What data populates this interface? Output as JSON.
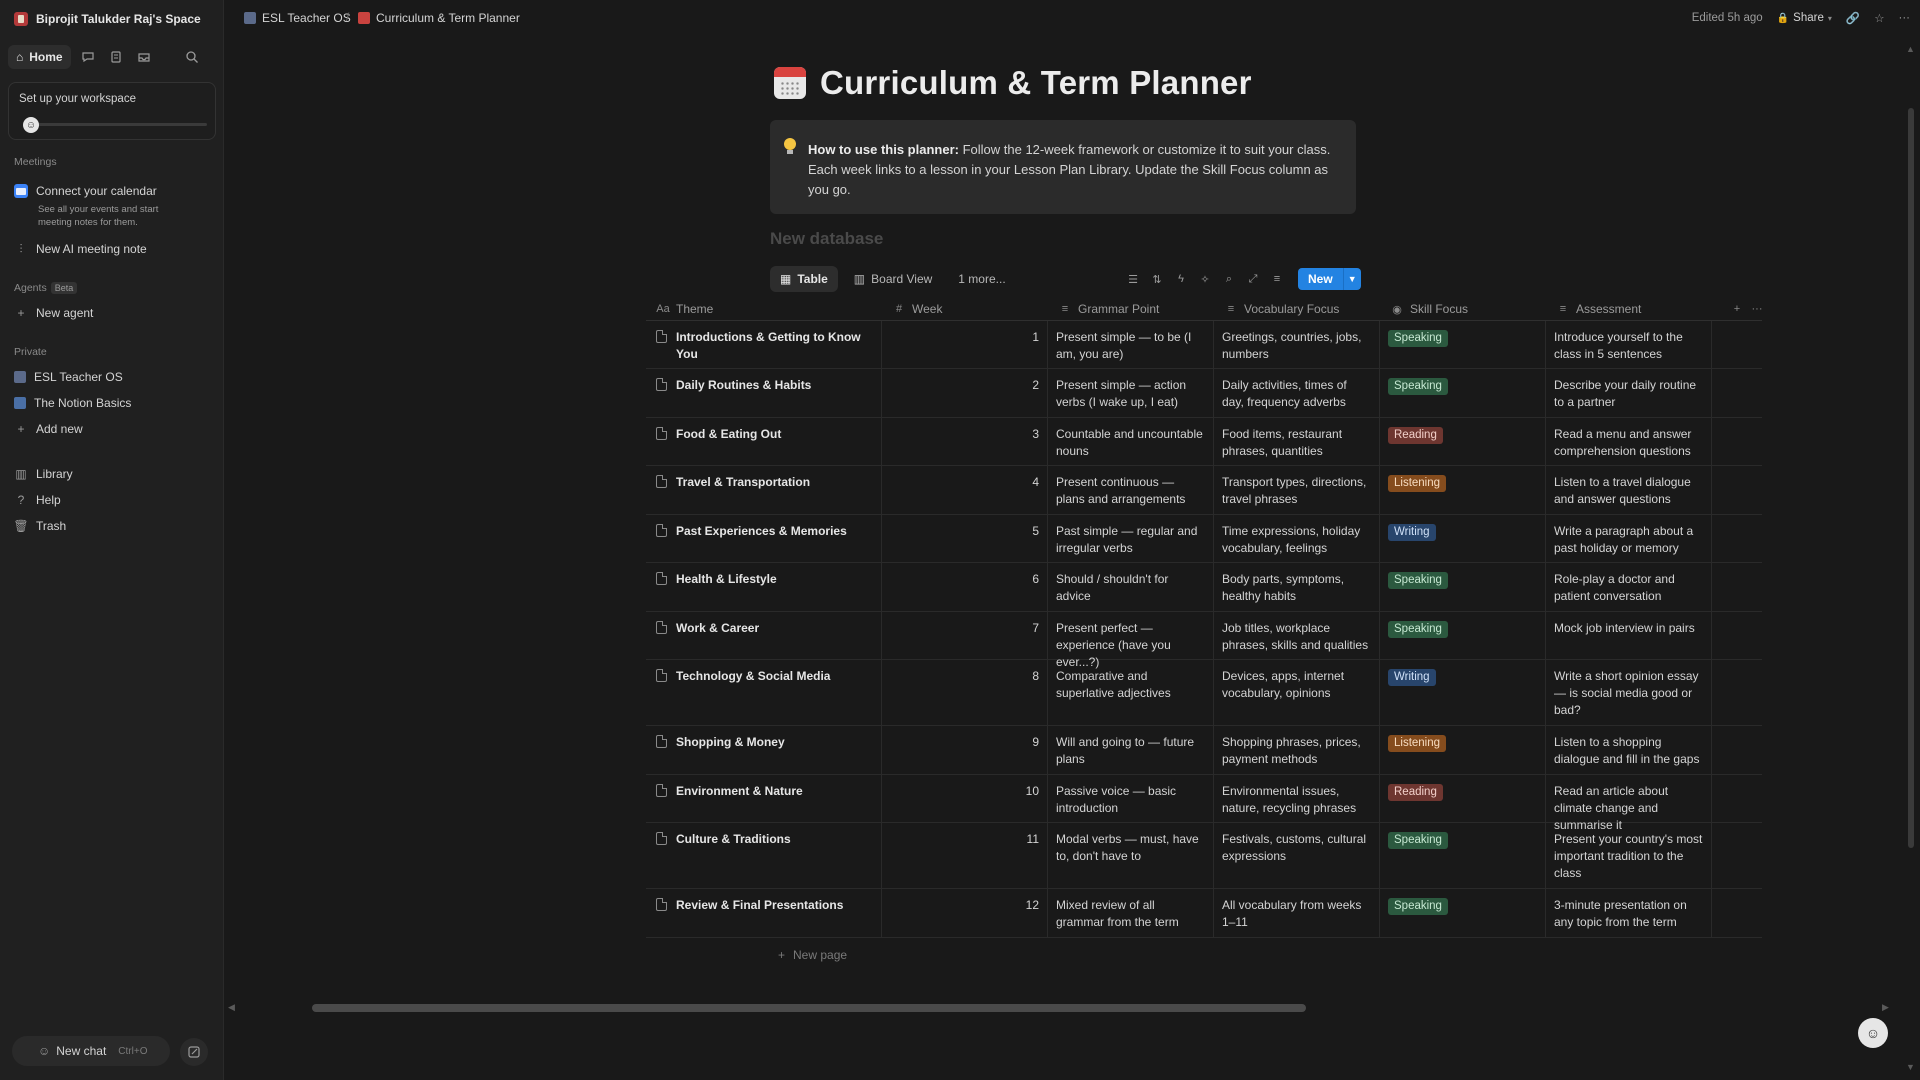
{
  "sidebar": {
    "workspace_name": "Biprojit Talukder Raj's Space",
    "home_label": "Home",
    "setup_title": "Set up your workspace",
    "setup_progress": 0.03,
    "meetings_label": "Meetings",
    "connect_calendar": "Connect your calendar",
    "connect_calendar_desc": "See all your events and start meeting notes for them.",
    "new_ai_note": "New AI meeting note",
    "agents_label": "Agents",
    "beta_label": "Beta",
    "new_agent": "New agent",
    "private_label": "Private",
    "private_items": [
      "ESL Teacher OS",
      "The Notion Basics"
    ],
    "add_new": "Add new",
    "library": "Library",
    "help": "Help",
    "trash": "Trash",
    "new_chat": "New chat",
    "new_chat_shortcut": "Ctrl+O"
  },
  "topbar": {
    "crumb1": "ESL Teacher OS",
    "crumb2": "Curriculum & Term Planner",
    "edited": "Edited 5h ago",
    "share": "Share"
  },
  "page": {
    "title": "Curriculum & Term Planner",
    "callout_bold": "How to use this planner:",
    "callout_text": " Follow the 12-week framework or customize it to suit your class. Each week links to a lesson in your Lesson Plan Library. Update the Skill Focus column as you go.",
    "db_title": "New database",
    "view_table": "Table",
    "view_board": "Board View",
    "view_more": "1 more...",
    "new_button": "New",
    "new_page": "New page"
  },
  "table": {
    "headers": [
      "Theme",
      "Week",
      "Grammar Point",
      "Vocabulary Focus",
      "Skill Focus",
      "Assessment"
    ],
    "rows": [
      {
        "theme": "Introductions & Getting to Know You",
        "week": "1",
        "grammar": "Present simple — to be (I am, you are)",
        "vocab": "Greetings, countries, jobs, numbers",
        "skill": "Speaking",
        "assess": " Introduce yourself to the class in 5 sentences"
      },
      {
        "theme": "Daily Routines & Habits",
        "week": "2",
        "grammar": "Present simple — action verbs (I wake up, I eat)",
        "vocab": "Daily activities, times of day, frequency adverbs",
        "skill": "Speaking",
        "assess": "Describe your daily routine to a partner"
      },
      {
        "theme": "Food & Eating Out",
        "week": "3",
        "grammar": "Countable and uncountable nouns",
        "vocab": "Food items, restaurant phrases, quantities",
        "skill": "Reading",
        "assess": "Read a menu and answer comprehension questions"
      },
      {
        "theme": "Travel & Transportation",
        "week": "4",
        "grammar": "Present continuous — plans and arrangements",
        "vocab": "Transport types, directions, travel phrases",
        "skill": "Listening",
        "assess": " Listen to a travel dialogue and answer questions"
      },
      {
        "theme": "Past Experiences & Memories",
        "week": "5",
        "grammar": "Past simple — regular and irregular verbs",
        "vocab": "Time expressions, holiday vocabulary, feelings",
        "skill": "Writing",
        "assess": "Write a paragraph about a past holiday or memory"
      },
      {
        "theme": "Health & Lifestyle",
        "week": "6",
        "grammar": "Should / shouldn't for advice",
        "vocab": "Body parts, symptoms, healthy habits",
        "skill": "Speaking",
        "assess": " Role-play a doctor and patient conversation"
      },
      {
        "theme": "Work & Career",
        "week": "7",
        "grammar": "Present perfect — experience (have you ever...?)",
        "vocab": "Job titles, workplace phrases, skills and qualities",
        "skill": "Speaking",
        "assess": " Mock job interview in pairs"
      },
      {
        "theme": "Technology & Social Media",
        "week": "8",
        "grammar": "Comparative and superlative adjectives",
        "vocab": "Devices, apps, internet vocabulary, opinions",
        "skill": "Writing",
        "assess": "Write a short opinion essay — is social media good or bad?"
      },
      {
        "theme": "Shopping & Money",
        "week": "9",
        "grammar": "Will and going to — future plans",
        "vocab": "Shopping phrases, prices, payment methods",
        "skill": "Listening",
        "assess": "Listen to a shopping dialogue and fill in the gaps"
      },
      {
        "theme": "Environment & Nature",
        "week": "10",
        "grammar": "Passive voice — basic introduction",
        "vocab": "Environmental issues, nature, recycling phrases",
        "skill": "Reading",
        "assess": " Read an article about climate change and summarise it"
      },
      {
        "theme": "Culture & Traditions",
        "week": "11",
        "grammar": "Modal verbs — must, have to, don't have to",
        "vocab": "Festivals, customs, cultural expressions",
        "skill": "Speaking",
        "assess": " Present your country's most important tradition to the class"
      },
      {
        "theme": "Review & Final Presentations",
        "week": "12",
        "grammar": "Mixed review of all grammar from the term",
        "vocab": "All vocabulary from weeks 1–11",
        "skill": "Speaking",
        "assess": " 3-minute presentation on any topic from the term"
      }
    ]
  },
  "colors": {
    "accent": "#2383e2",
    "speaking": "#2b593f",
    "reading": "#6e3630",
    "listening": "#854c1d",
    "writing": "#28456c"
  }
}
